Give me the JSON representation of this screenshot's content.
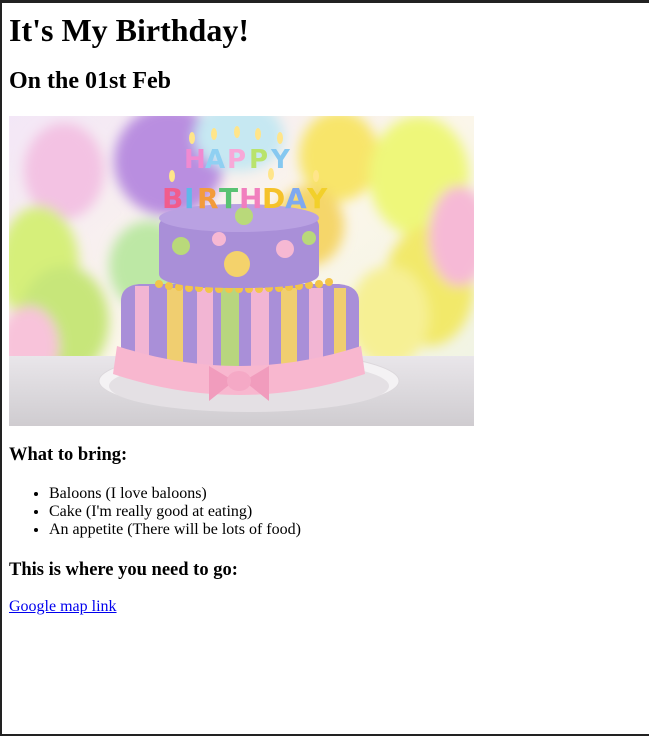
{
  "page": {
    "title": "It's My Birthday!",
    "subtitle": "On the 01st Feb"
  },
  "image": {
    "alt": "Birthday cake",
    "candles_text": "HAPPY BIRTHDAY"
  },
  "bring": {
    "heading": "What to bring:",
    "items": [
      "Baloons (I love baloons)",
      "Cake (I'm really good at eating)",
      "An appetite (There will be lots of food)"
    ]
  },
  "location": {
    "heading": "This is where you need to go:",
    "link_text": "Google map link"
  },
  "colors": {
    "link": "#0000ee",
    "cake_purple": "#a98fd8",
    "cake_pink": "#f6b8d3",
    "cake_yellow": "#f4d26b",
    "cake_green": "#b9d97a"
  }
}
